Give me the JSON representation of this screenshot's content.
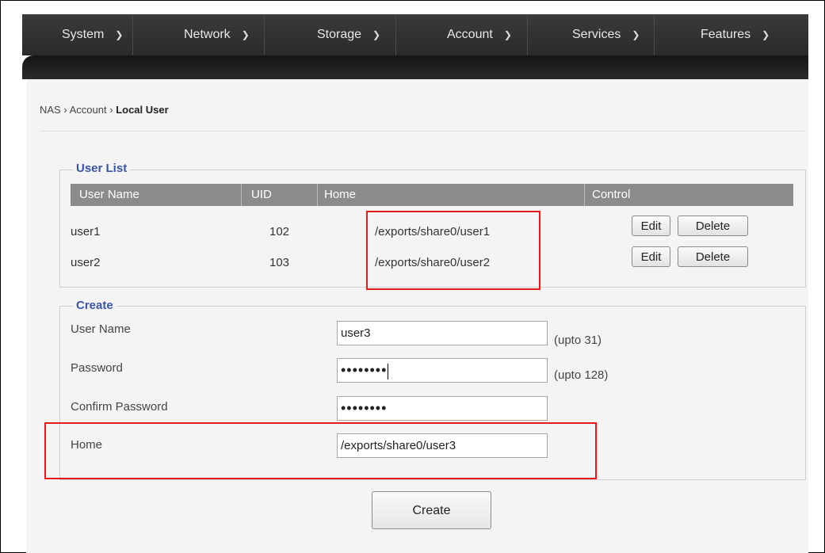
{
  "nav": {
    "items": [
      {
        "label": "System"
      },
      {
        "label": "Network"
      },
      {
        "label": "Storage"
      },
      {
        "label": "Account"
      },
      {
        "label": "Services"
      },
      {
        "label": "Features"
      }
    ]
  },
  "breadcrumb": {
    "part1": "NAS",
    "sep": "›",
    "part2": "Account",
    "current": "Local User"
  },
  "user_list": {
    "legend": "User List",
    "columns": [
      "User Name",
      "UID",
      "Home",
      "Control"
    ],
    "rows": [
      {
        "name": "user1",
        "uid": "102",
        "home": "/exports/share0/user1",
        "edit": "Edit",
        "delete": "Delete"
      },
      {
        "name": "user2",
        "uid": "103",
        "home": "/exports/share0/user2",
        "edit": "Edit",
        "delete": "Delete"
      }
    ]
  },
  "create": {
    "legend": "Create",
    "username_label": "User Name",
    "username_value": "user3",
    "username_hint": "(upto 31)",
    "password_label": "Password",
    "password_value": "••••••••",
    "password_hint": "(upto 128)",
    "confirm_label": "Confirm Password",
    "confirm_value": "••••••••",
    "home_label": "Home",
    "home_value": "/exports/share0/user3",
    "button": "Create"
  },
  "colors": {
    "highlight": "#e41b1b",
    "legend": "#3a55a8",
    "nav_bg": "#333333",
    "table_header": "#8b8b8b"
  },
  "icons": {
    "nav_dropdown": "chevron-down-icon"
  }
}
